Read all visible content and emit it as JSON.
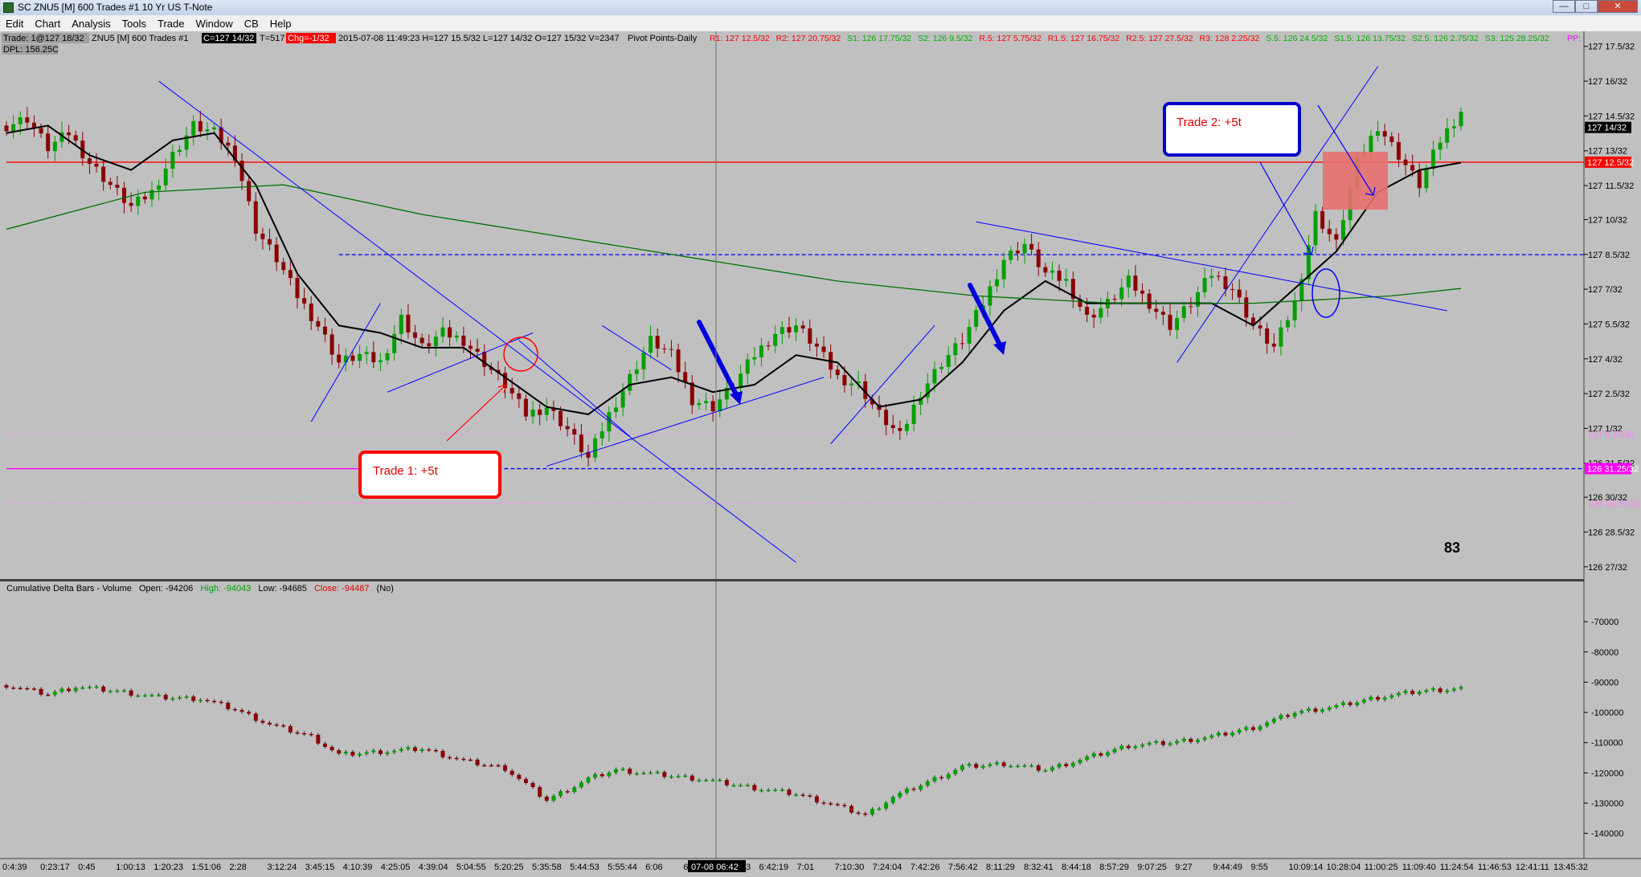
{
  "window": {
    "title": "SC ZNU5 [M]  600 Trades  #1  10 Yr US T-Note",
    "menu": [
      "Edit",
      "Chart",
      "Analysis",
      "Tools",
      "Trade",
      "Window",
      "CB",
      "Help"
    ]
  },
  "header": {
    "trade_label": "Trade: 1@127 18/32",
    "dpl_label": "DPL: 156.25C",
    "instrument": "ZNU5 [M]  600 Trades  #1",
    "last_price": "C=127 14/32",
    "ticks": "T=517",
    "change": "Chg=-1/32",
    "stats": "2015-07-08 11:49:23 H=127 15.5/32 L=127 14/32 O=127 15/32 V=2347",
    "pivot_title": "Pivot Points-Daily",
    "pivots_red": [
      "R1: 127 12.5/32",
      "R2: 127 20.75/32"
    ],
    "pivots_green": [
      "S1: 126 17.75/32",
      "S2: 126 9.5/32"
    ],
    "pivots_red2": [
      "R.5: 127 5.75/32",
      "R1.5: 127 16.75/32",
      "R2.5: 127 27.5/32",
      "R3: 128 2.25/32"
    ],
    "pivots_green2": [
      "S.5: 126 24.5/32",
      "S1.5: 126 13.75/32",
      "S2.5: 126 2.75/32",
      "S3: 125 28.25/32"
    ],
    "pivot_pp": "PP:"
  },
  "annotations": {
    "trade1": "Trade 1: +5t",
    "trade2": "Trade 2: +5t",
    "count_label": "83"
  },
  "lower_panel": {
    "title": "Cumulative Delta Bars - Volume",
    "open_label": "Open: -94206",
    "high_label": "High: -94043",
    "low_label": "Low: -94685",
    "close_label": "Close: -94487",
    "flag": "(No)"
  },
  "cursor_time_label": "07-08  06:42",
  "colors": {
    "background": "#c0c0c0",
    "price_up": "#00a000",
    "price_down": "#8b0000",
    "trendline": "#0000ff",
    "pivot_red": "#ff0000",
    "pivot_green": "#00b000",
    "pivot_magenta": "#ff00ff",
    "callout_red": "#ff0000",
    "callout_blue": "#0000cc",
    "box_fill": "#e87070"
  },
  "chart_data": [
    {
      "type": "candlestick",
      "title": "ZNU5 [M] 600 Trades #1",
      "y_ticks": [
        "127 17.5/32",
        "127 16/32",
        "127 14.5/32",
        "127 13/32",
        "127 11.5/32",
        "127 10/32",
        "127 8.5/32",
        "127 7/32",
        "127 5.5/32",
        "127 4/32",
        "127 2.5/32",
        "127 1/32",
        "126 31.5/32",
        "126 30/32",
        "126 28.5/32",
        "126 27/32"
      ],
      "y_tick_values": [
        127.547,
        127.5,
        127.453,
        127.406,
        127.359,
        127.313,
        127.266,
        127.219,
        127.172,
        127.125,
        127.078,
        127.031,
        126.984,
        126.938,
        126.891,
        126.844
      ],
      "ylim": [
        126.834,
        127.563
      ],
      "price_boxes": [
        {
          "label": "127 14/32",
          "value": 127.4375,
          "bg": "#000000",
          "fg": "#ffffff"
        },
        {
          "label": "127 12.5/32",
          "value": 127.3906,
          "bg": "#ff0000",
          "fg": "#ffffff"
        },
        {
          "label": "126 31.25/32",
          "value": 126.9766,
          "bg": "#ff00ff",
          "fg": "#ffffff"
        }
      ],
      "faint_pivot_labels": [
        {
          "label": "127 0.75/32",
          "value": 127.0234,
          "color": "#ff80ff"
        },
        {
          "label": "126 28.25/32",
          "value": 126.9297,
          "color": "#ff80ff"
        }
      ],
      "x_ticks": [
        "0:4:39",
        "0:23:17",
        "0:45",
        "1:00:13",
        "1:20:23",
        "1:51:06",
        "2:28",
        "3:12:24",
        "3:45:15",
        "4:10:39",
        "4:25:05",
        "4:39:04",
        "5:04:55",
        "5:20:25",
        "5:35:58",
        "5:44:53",
        "5:55:44",
        "6:06",
        "6:16:55",
        "6:32:03",
        "6:42:19",
        "7:01",
        "7:10:30",
        "7:24:04",
        "7:42:26",
        "7:56:42",
        "8:11:29",
        "8:32:41",
        "8:44:18",
        "8:57:29",
        "9:07:25",
        "9:27",
        "9:44:49",
        "9:55",
        "10:09:14",
        "10:28:04",
        "11:00:25",
        "11:09:40",
        "11:24:54",
        "11:46:53",
        "12:41:11",
        "13:45:32"
      ],
      "close_path": [
        [
          0,
          127.44
        ],
        [
          3,
          127.45
        ],
        [
          6,
          127.41
        ],
        [
          9,
          127.43
        ],
        [
          12,
          127.39
        ],
        [
          15,
          127.36
        ],
        [
          18,
          127.33
        ],
        [
          21,
          127.35
        ],
        [
          24,
          127.4
        ],
        [
          27,
          127.44
        ],
        [
          30,
          127.43
        ],
        [
          33,
          127.4
        ],
        [
          36,
          127.3
        ],
        [
          39,
          127.26
        ],
        [
          42,
          127.21
        ],
        [
          45,
          127.17
        ],
        [
          48,
          127.12
        ],
        [
          51,
          127.13
        ],
        [
          54,
          127.12
        ],
        [
          57,
          127.18
        ],
        [
          60,
          127.14
        ],
        [
          63,
          127.16
        ],
        [
          66,
          127.15
        ],
        [
          69,
          127.12
        ],
        [
          72,
          127.09
        ],
        [
          75,
          127.05
        ],
        [
          78,
          127.06
        ],
        [
          81,
          127.03
        ],
        [
          84,
          126.99
        ],
        [
          87,
          127.05
        ],
        [
          90,
          127.1
        ],
        [
          93,
          127.15
        ],
        [
          96,
          127.13
        ],
        [
          99,
          127.07
        ],
        [
          102,
          127.06
        ],
        [
          105,
          127.09
        ],
        [
          108,
          127.13
        ],
        [
          111,
          127.16
        ],
        [
          114,
          127.17
        ],
        [
          117,
          127.14
        ],
        [
          120,
          127.1
        ],
        [
          123,
          127.09
        ],
        [
          126,
          127.05
        ],
        [
          129,
          127.02
        ],
        [
          132,
          127.08
        ],
        [
          135,
          127.12
        ],
        [
          138,
          127.15
        ],
        [
          141,
          127.2
        ],
        [
          144,
          127.26
        ],
        [
          147,
          127.28
        ],
        [
          150,
          127.24
        ],
        [
          153,
          127.23
        ],
        [
          156,
          127.18
        ],
        [
          159,
          127.2
        ],
        [
          162,
          127.23
        ],
        [
          165,
          127.2
        ],
        [
          168,
          127.17
        ],
        [
          171,
          127.2
        ],
        [
          174,
          127.24
        ],
        [
          177,
          127.22
        ],
        [
          180,
          127.17
        ],
        [
          183,
          127.14
        ],
        [
          186,
          127.2
        ],
        [
          189,
          127.32
        ],
        [
          192,
          127.28
        ],
        [
          195,
          127.39
        ],
        [
          198,
          127.44
        ],
        [
          201,
          127.4
        ],
        [
          204,
          127.36
        ],
        [
          207,
          127.42
        ],
        [
          210,
          127.46
        ]
      ],
      "series": [
        {
          "name": "",
          "type": "line",
          "color": "#000000",
          "values": [
            [
              0,
              127.43
            ],
            [
              6,
              127.44
            ],
            [
              12,
              127.4
            ],
            [
              18,
              127.38
            ],
            [
              24,
              127.42
            ],
            [
              30,
              127.43
            ],
            [
              36,
              127.36
            ],
            [
              42,
              127.24
            ],
            [
              48,
              127.17
            ],
            [
              54,
              127.16
            ],
            [
              60,
              127.14
            ],
            [
              66,
              127.14
            ],
            [
              72,
              127.1
            ],
            [
              78,
              127.06
            ],
            [
              84,
              127.05
            ],
            [
              90,
              127.09
            ],
            [
              96,
              127.1
            ],
            [
              102,
              127.08
            ],
            [
              108,
              127.09
            ],
            [
              114,
              127.13
            ],
            [
              120,
              127.12
            ],
            [
              126,
              127.06
            ],
            [
              132,
              127.07
            ],
            [
              138,
              127.12
            ],
            [
              144,
              127.19
            ],
            [
              150,
              127.23
            ],
            [
              156,
              127.2
            ],
            [
              162,
              127.2
            ],
            [
              168,
              127.2
            ],
            [
              174,
              127.2
            ],
            [
              180,
              127.17
            ],
            [
              186,
              127.22
            ],
            [
              192,
              127.27
            ],
            [
              198,
              127.35
            ],
            [
              204,
              127.38
            ],
            [
              210,
              127.39
            ]
          ]
        },
        {
          "name": "",
          "type": "line",
          "color": "#007000",
          "values": [
            [
              0,
              127.3
            ],
            [
              20,
              127.35
            ],
            [
              40,
              127.36
            ],
            [
              60,
              127.32
            ],
            [
              80,
              127.29
            ],
            [
              100,
              127.26
            ],
            [
              120,
              127.23
            ],
            [
              140,
              127.21
            ],
            [
              160,
              127.2
            ],
            [
              180,
              127.2
            ],
            [
              200,
              127.21
            ],
            [
              210,
              127.22
            ]
          ]
        }
      ],
      "hlines": [
        {
          "value": 127.3906,
          "color": "#ff0000",
          "style": "solid",
          "x_from": 0,
          "x_to": 210
        },
        {
          "value": 127.2656,
          "color": "#0000ff",
          "style": "dashed",
          "x_from": 48,
          "x_to": 210
        },
        {
          "value": 126.9766,
          "color": "#0000ff",
          "style": "dashed",
          "x_from": 70,
          "x_to": 210
        },
        {
          "value": 126.9766,
          "color": "#ff00ff",
          "style": "solid",
          "x_from": 0,
          "x_to": 70
        },
        {
          "value": 127.0234,
          "color": "#ff80ff",
          "style": "dotted",
          "x_from": 0,
          "x_to": 186
        },
        {
          "value": 126.9297,
          "color": "#ff80ff",
          "style": "dotted",
          "x_from": 0,
          "x_to": 186
        }
      ],
      "trendlines": [
        [
          [
            22,
            127.5
          ],
          [
            114,
            126.85
          ]
        ],
        [
          [
            44,
            127.04
          ],
          [
            54,
            127.2
          ]
        ],
        [
          [
            55,
            127.08
          ],
          [
            76,
            127.16
          ]
        ],
        [
          [
            78,
            126.98
          ],
          [
            118,
            127.1
          ]
        ],
        [
          [
            119,
            127.01
          ],
          [
            134,
            127.17
          ]
        ],
        [
          [
            140,
            127.31
          ],
          [
            208,
            127.19
          ]
        ],
        [
          [
            169,
            127.12
          ],
          [
            198,
            127.52
          ]
        ],
        [
          [
            74,
            127.15
          ],
          [
            90,
            127.02
          ]
        ],
        [
          [
            86,
            127.17
          ],
          [
            96,
            127.11
          ]
        ]
      ]
    },
    {
      "type": "bar",
      "title": "Cumulative Delta Bars - Volume",
      "y_ticks": [
        "-70000",
        "-80000",
        "-90000",
        "-100000",
        "-110000",
        "-120000",
        "-130000",
        "-140000"
      ],
      "y_tick_values": [
        -70000,
        -80000,
        -90000,
        -100000,
        -110000,
        -120000,
        -130000,
        -140000
      ],
      "ylim": [
        -147000,
        -62000
      ],
      "values": [
        [
          0,
          -91000
        ],
        [
          6,
          -94000
        ],
        [
          10,
          -91500
        ],
        [
          16,
          -93000
        ],
        [
          22,
          -95000
        ],
        [
          28,
          -95500
        ],
        [
          33,
          -99000
        ],
        [
          38,
          -104000
        ],
        [
          44,
          -108000
        ],
        [
          48,
          -114000
        ],
        [
          54,
          -113000
        ],
        [
          60,
          -112000
        ],
        [
          66,
          -116000
        ],
        [
          72,
          -118500
        ],
        [
          78,
          -129000
        ],
        [
          84,
          -122000
        ],
        [
          88,
          -119000
        ],
        [
          92,
          -120000
        ],
        [
          100,
          -122000
        ],
        [
          108,
          -125000
        ],
        [
          114,
          -127000
        ],
        [
          120,
          -131000
        ],
        [
          124,
          -134000
        ],
        [
          128,
          -128000
        ],
        [
          132,
          -124000
        ],
        [
          138,
          -118000
        ],
        [
          144,
          -117000
        ],
        [
          150,
          -119000
        ],
        [
          156,
          -115000
        ],
        [
          162,
          -111000
        ],
        [
          168,
          -110000
        ],
        [
          174,
          -108000
        ],
        [
          180,
          -105000
        ],
        [
          186,
          -100000
        ],
        [
          192,
          -98000
        ],
        [
          198,
          -95000
        ],
        [
          204,
          -93000
        ],
        [
          210,
          -92000
        ]
      ]
    }
  ]
}
